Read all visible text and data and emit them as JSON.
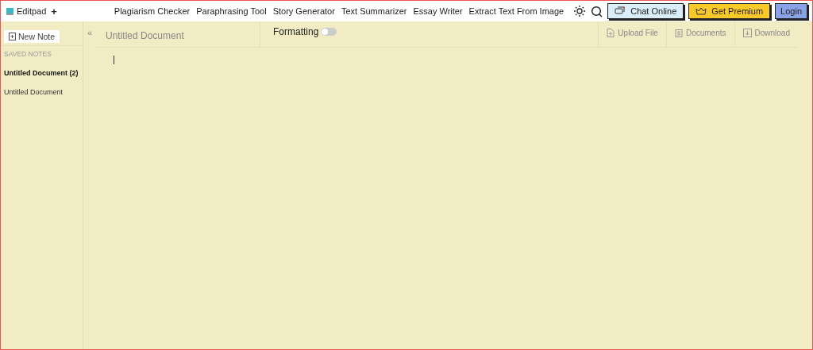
{
  "brand": {
    "name": "Editpad",
    "plus": "+"
  },
  "nav": [
    "Plagiarism Checker",
    "Paraphrasing Tool",
    "Story Generator",
    "Text Summarizer",
    "Essay Writer",
    "Extract Text From Image"
  ],
  "header_buttons": [
    {
      "label": "Chat Online",
      "kind": "chat"
    },
    {
      "label": "Get Premium",
      "kind": "premium"
    },
    {
      "label": "Login",
      "kind": "login"
    }
  ],
  "sidebar": {
    "new_note": "New Note",
    "collapse": "«",
    "section": "SAVED NOTES",
    "items": [
      {
        "label": "Untitled Document (2)",
        "selected": true
      },
      {
        "label": "Untitled Document",
        "selected": false
      }
    ]
  },
  "toolbar": {
    "title": "Untitled Document",
    "formatting": {
      "label": "Formatting",
      "on": false
    },
    "actions": [
      {
        "label": "Upload File",
        "kind": "upload"
      },
      {
        "label": "Documents",
        "kind": "documents"
      },
      {
        "label": "Download",
        "kind": "download"
      }
    ]
  }
}
